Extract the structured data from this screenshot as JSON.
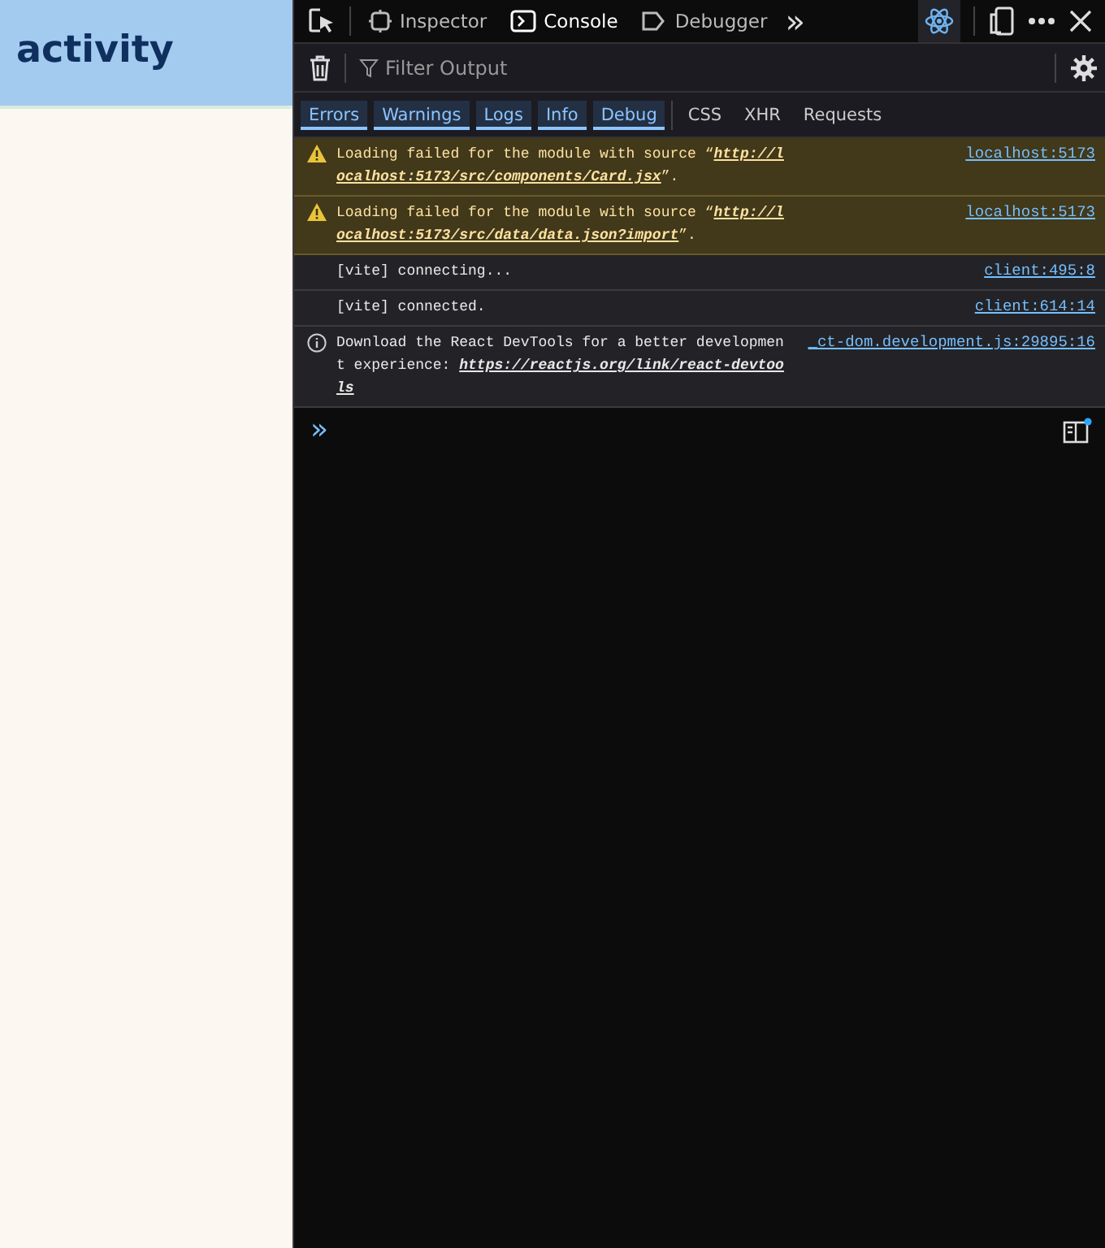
{
  "page": {
    "heading": "activity"
  },
  "toolbar": {
    "tabs": [
      {
        "label": "Inspector",
        "selected": false
      },
      {
        "label": "Console",
        "selected": true
      },
      {
        "label": "Debugger",
        "selected": false
      }
    ],
    "overflow": "»"
  },
  "filter_bar": {
    "placeholder": "Filter Output"
  },
  "filters": [
    {
      "label": "Errors",
      "selected": true
    },
    {
      "label": "Warnings",
      "selected": true
    },
    {
      "label": "Logs",
      "selected": true
    },
    {
      "label": "Info",
      "selected": true
    },
    {
      "label": "Debug",
      "selected": true
    },
    {
      "label": "CSS",
      "selected": false
    },
    {
      "label": "XHR",
      "selected": false
    },
    {
      "label": "Requests",
      "selected": false
    }
  ],
  "messages": [
    {
      "kind": "warning",
      "parts": [
        {
          "text": "Loading failed for the module with source “",
          "link": false
        },
        {
          "text": "http://localhost:5173/src/components/Card.jsx",
          "link": true
        },
        {
          "text": "”.",
          "link": false
        }
      ],
      "source": "localhost:5173"
    },
    {
      "kind": "warning",
      "parts": [
        {
          "text": "Loading failed for the module with source “",
          "link": false
        },
        {
          "text": "http://localhost:5173/src/data/data.json?import",
          "link": true
        },
        {
          "text": "”.",
          "link": false
        }
      ],
      "source": "localhost:5173"
    },
    {
      "kind": "log",
      "parts": [
        {
          "text": "[vite] connecting...",
          "link": false
        }
      ],
      "source": "client:495:8"
    },
    {
      "kind": "log",
      "parts": [
        {
          "text": "[vite] connected.",
          "link": false
        }
      ],
      "source": "client:614:14"
    },
    {
      "kind": "info",
      "parts": [
        {
          "text": "Download the React DevTools for a better development experience: ",
          "link": false
        },
        {
          "text": "https://reactjs.org/link/react-devtools",
          "link": true
        }
      ],
      "source": "_ct-dom.development.js:29895:16"
    }
  ],
  "prompt": "»"
}
